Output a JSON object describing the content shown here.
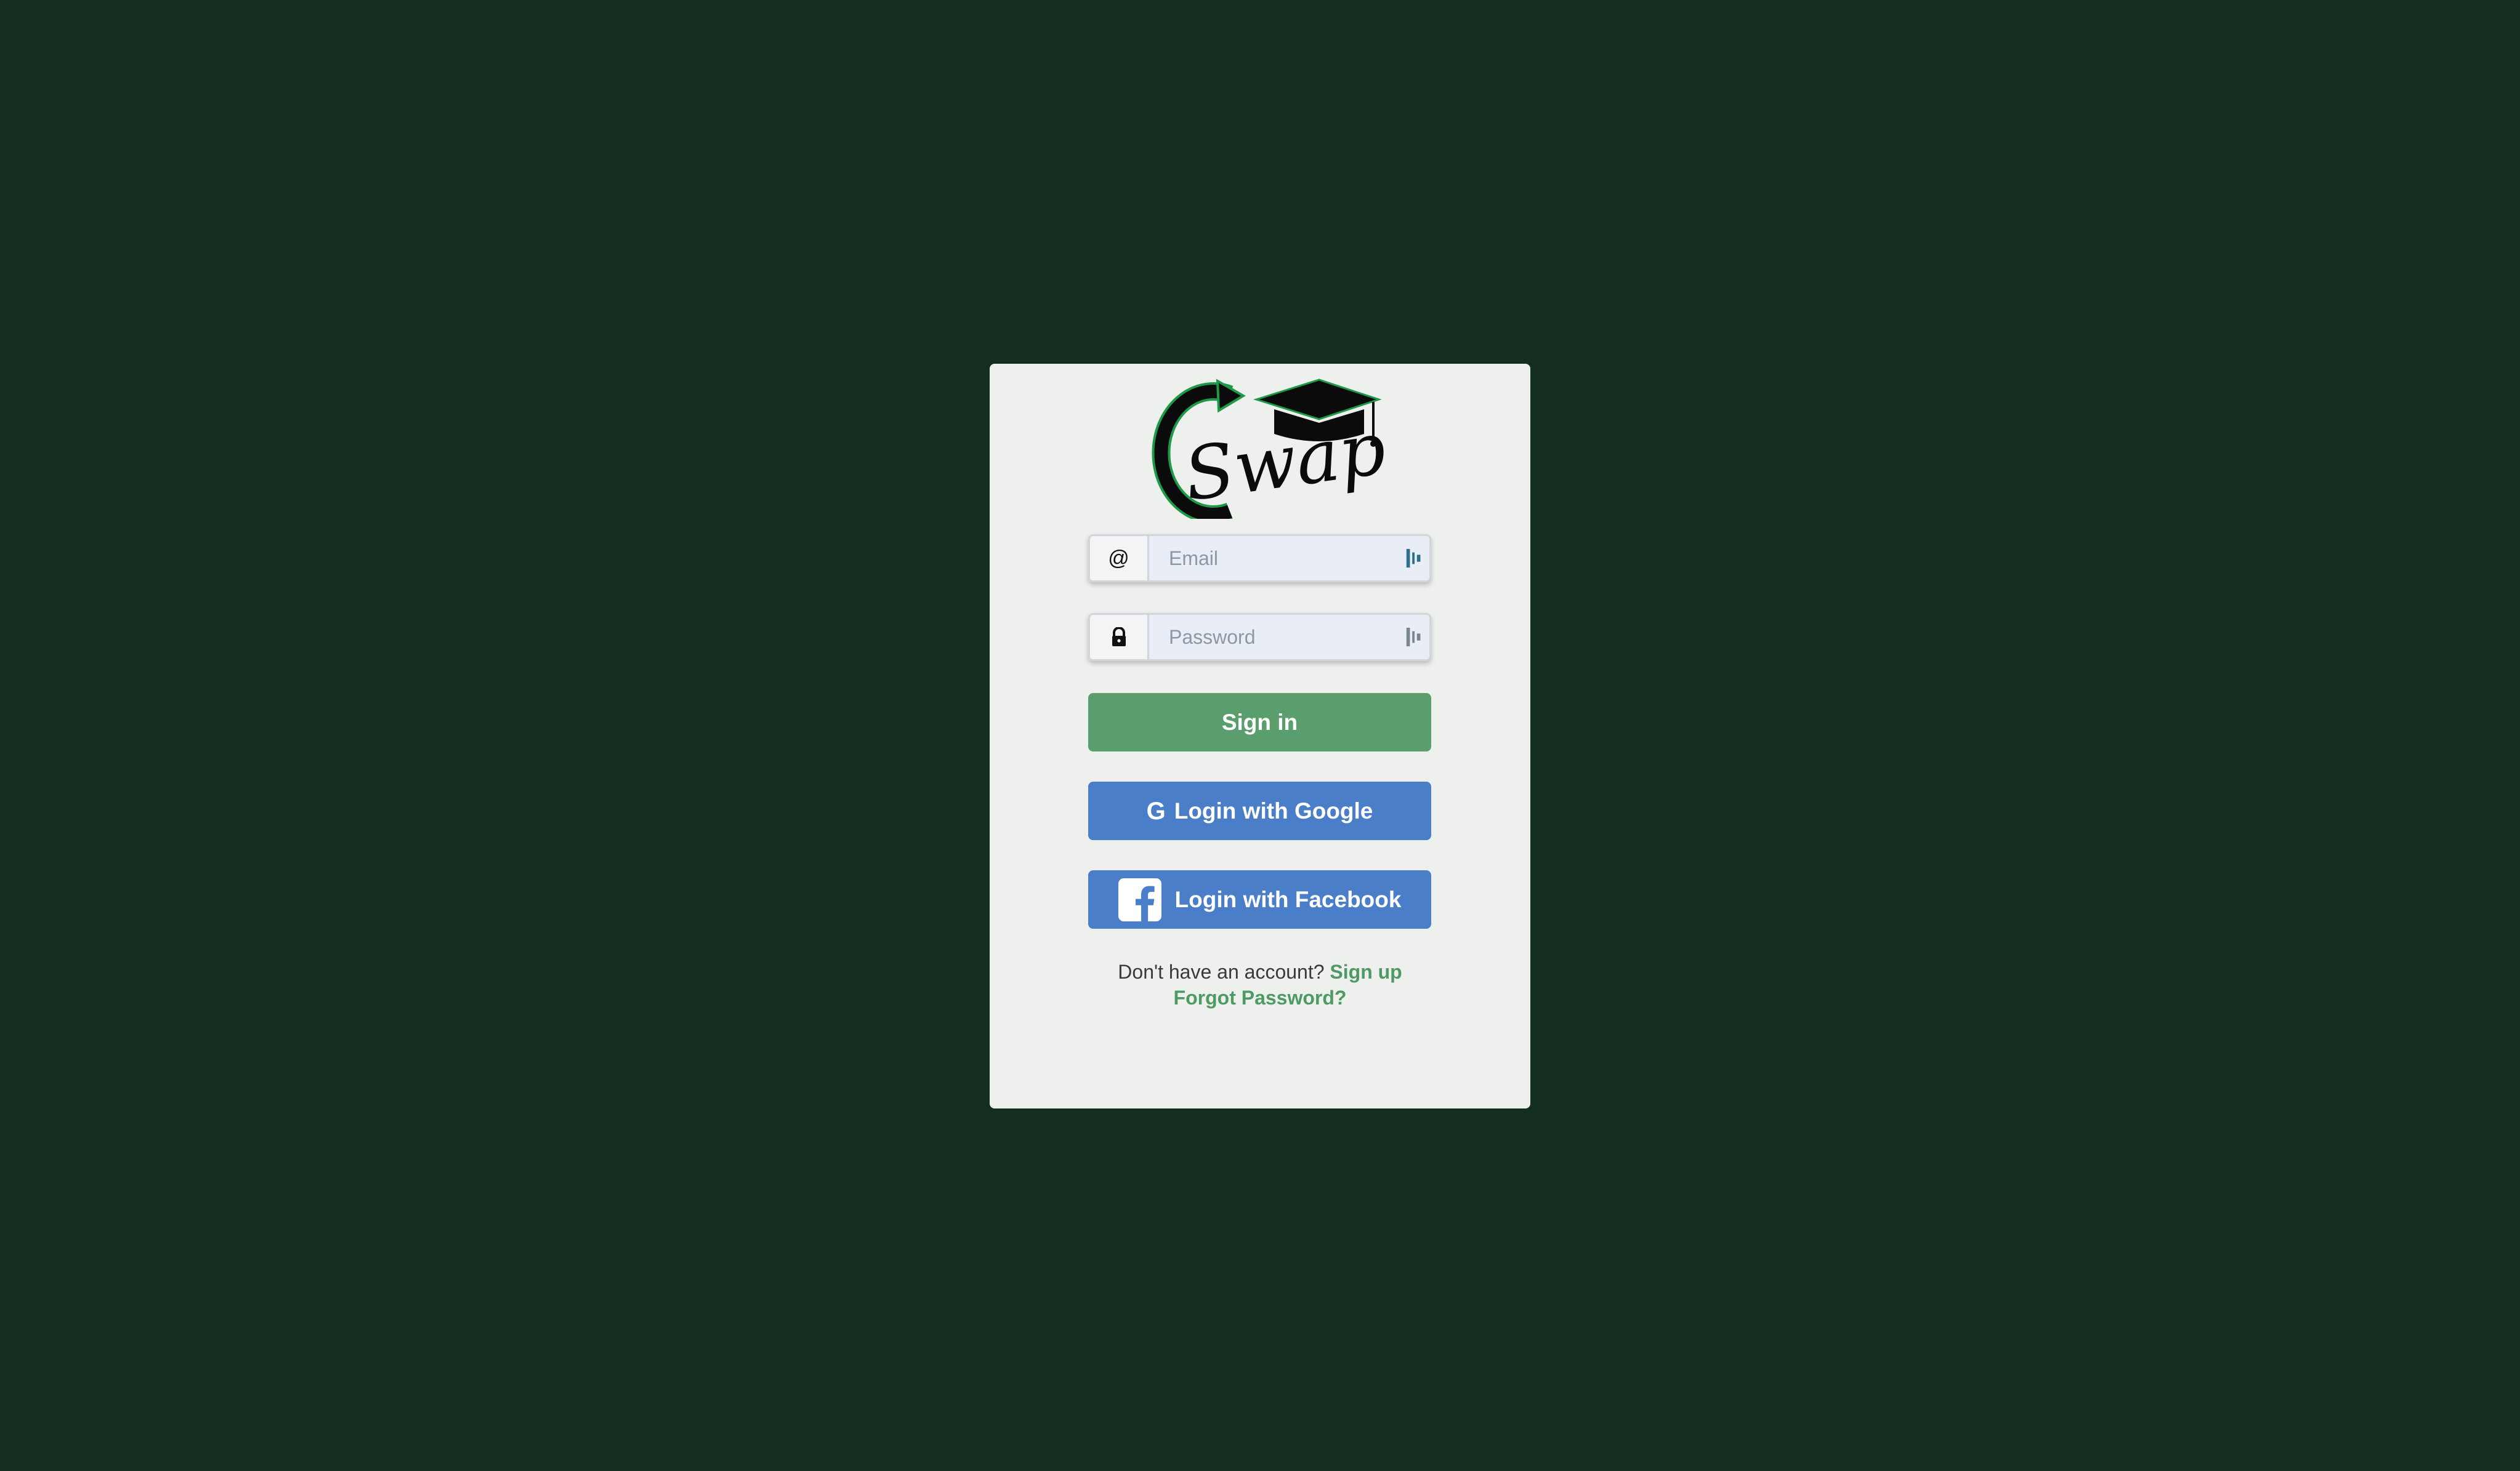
{
  "login": {
    "logo_text": "Swap",
    "email": {
      "placeholder": "Email",
      "value": ""
    },
    "password": {
      "placeholder": "Password",
      "value": ""
    },
    "signin_label": "Sign in",
    "google_label": "Login with Google",
    "facebook_label": "Login with Facebook",
    "no_account_text": "Don't have an account?",
    "signup_label": "Sign up",
    "forgot_label": "Forgot Password?"
  },
  "icons": {
    "email": "at-icon",
    "password": "lock-icon",
    "google": "google-icon",
    "facebook": "facebook-icon",
    "logo": "graduation-cap-swap-logo"
  },
  "colors": {
    "background": "#142f22",
    "card": "#eef0ee",
    "signin": "#5b9e6d",
    "social": "#4a7ec8",
    "link": "#4d9a62"
  }
}
